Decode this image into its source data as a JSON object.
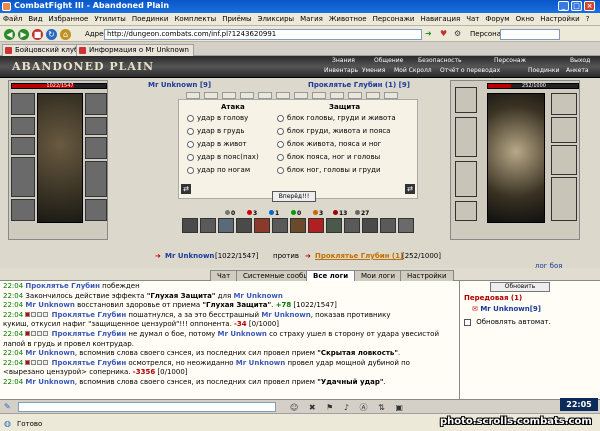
{
  "window": {
    "title": "CombatFight III - Abandoned Plain"
  },
  "menu": [
    "Файл",
    "Вид",
    "Избранное",
    "Утилиты",
    "Поединки",
    "Комплекты",
    "Приёмы",
    "Эликсиры",
    "Магия",
    "Животное",
    "Персонажи",
    "Навигация",
    "Чат",
    "Форум",
    "Окно",
    "Настройки",
    "?"
  ],
  "address": {
    "label": "Адрес:",
    "value": "http://dungeon.combats.com/inf.pl?1243620991",
    "persona_label": "Персонаж:"
  },
  "tabs": [
    "Бойцовский клуб",
    "Информация о Mr Unknown"
  ],
  "game": {
    "logo": "ABANDONED PLAIN",
    "top_menu_1": [
      "Знания",
      "Общение",
      "Безопасность",
      "Персонаж",
      "Выход"
    ],
    "top_menu_2": [
      "Инвентарь",
      "Умения",
      "Мой Скролл",
      "Отчёт о переводах",
      "Поединки",
      "Анкета"
    ],
    "player": {
      "name": "Mr Unknown [9]",
      "hp_text": "1022/1547",
      "hp_fraction": 0.66
    },
    "opponent": {
      "name": "Проклятье Глубин (1) [9]",
      "hp_text": "252/1000",
      "hp_fraction": 0.252
    },
    "attack_header": "Атака",
    "defense_header": "Защита",
    "attacks": [
      "удар в голову",
      "удар в грудь",
      "удар в живот",
      "удар в пояс(пах)",
      "удар по ногам"
    ],
    "defenses": [
      "блок головы, груди и живота",
      "блок груди, живота и пояса",
      "блок живота, пояса и ног",
      "блок пояса, ног и головы",
      "блок ног, головы и груди"
    ],
    "forward_button": "Вперёд!!!",
    "stats": [
      "0",
      "3",
      "1",
      "0",
      "3",
      "13",
      "27"
    ],
    "vs": {
      "player": "Mr Unknown",
      "player_hp": "[1022/1547]",
      "word": "против",
      "opponent": "Проклятье Глубин (1)",
      "opponent_hp": "[252/1000]"
    },
    "log_link": "лог боя"
  },
  "log_tabs": [
    "Чат",
    "Системные сообщения",
    "Все логи",
    "Мои логи",
    "Настройки"
  ],
  "log": [
    {
      "time": "22:04",
      "parts": [
        [
          "opp",
          "Проклятье Глубин"
        ],
        [
          "t",
          " побежден"
        ]
      ]
    },
    {
      "time": "22:04",
      "parts": [
        [
          "t",
          "Закончилось действие эффекта "
        ],
        [
          "b",
          "\"Глухая Защита\""
        ],
        [
          "t",
          " для "
        ],
        [
          "name",
          "Mr Unknown"
        ]
      ]
    },
    {
      "time": "22:04",
      "parts": [
        [
          "name",
          "Mr Unknown"
        ],
        [
          "t",
          " восстановил здоровье от приема "
        ],
        [
          "b",
          "\"Глухая Защита\""
        ],
        [
          "t",
          ". "
        ],
        [
          "heal",
          "+78"
        ],
        [
          "t",
          " [1022/1547]"
        ]
      ]
    },
    {
      "time": "22:04",
      "sq": true,
      "parts": [
        [
          "opp",
          "Проклятье Глубин"
        ],
        [
          "t",
          " пошатнулся, а за это бесстрашный "
        ],
        [
          "name",
          "Mr Unknown"
        ],
        [
          "t",
          ", показав противнику"
        ]
      ]
    },
    {
      "time": "",
      "parts": [
        [
          "t",
          "кукиш, откусил нафиг \"защищенное цензурой\"!!! оппонента. "
        ],
        [
          "dmg",
          "-34"
        ],
        [
          "t",
          " [0/1000]"
        ]
      ]
    },
    {
      "time": "22:04",
      "sq": true,
      "parts": [
        [
          "opp",
          "Проклятье Глубин"
        ],
        [
          "t",
          " не думал о бое, потому "
        ],
        [
          "name",
          "Mr Unknown"
        ],
        [
          "t",
          " со страху ушел в сторону от удара увесистой"
        ]
      ]
    },
    {
      "time": "",
      "parts": [
        [
          "t",
          "лапой в грудь и провел контрудар."
        ]
      ]
    },
    {
      "time": "22:04",
      "parts": [
        [
          "name",
          "Mr Unknown"
        ],
        [
          "t",
          ", вспомнив слова своего сэнсея, из последних сил провел прием "
        ],
        [
          "b",
          "\"Скрытая ловкость\""
        ],
        [
          "t",
          "."
        ]
      ]
    },
    {
      "time": "22:04",
      "sq": true,
      "parts": [
        [
          "opp",
          "Проклятье Глубин"
        ],
        [
          "t",
          " осмотрелся, но неожиданно "
        ],
        [
          "name",
          "Mr Unknown"
        ],
        [
          "t",
          " провел удар мощной дубиной по"
        ]
      ]
    },
    {
      "time": "",
      "parts": [
        [
          "t",
          "<вырезано цензурой> соперника. "
        ],
        [
          "dmg",
          "-3356"
        ],
        [
          "t",
          " [0/1000]"
        ]
      ]
    },
    {
      "time": "22:04",
      "parts": [
        [
          "name",
          "Mr Unknown"
        ],
        [
          "t",
          ", вспомнив слова своего сэнсея, из последних сил провел прием "
        ],
        [
          "b",
          "\"Удачный удар\""
        ],
        [
          "t",
          "."
        ]
      ]
    }
  ],
  "right_panel": {
    "refresh": "Обновить",
    "front": "Передовая (1)",
    "member": "Mr Unknown[9]",
    "auto_refresh": "Обновлять автомат."
  },
  "status": {
    "text": "Готово",
    "clock": "22:05",
    "watermark": "photo.scrolls.combats.com"
  }
}
